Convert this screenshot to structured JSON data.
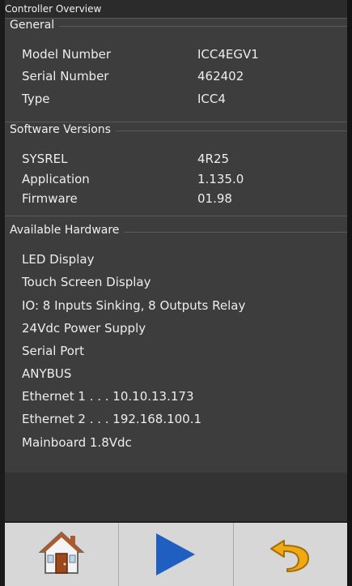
{
  "window": {
    "title": "Controller Overview"
  },
  "general": {
    "header": "General",
    "rows": [
      {
        "label": "Model Number",
        "value": "ICC4EGV1"
      },
      {
        "label": "Serial Number",
        "value": "462402"
      },
      {
        "label": "Type",
        "value": "ICC4"
      }
    ]
  },
  "software": {
    "header": "Software Versions",
    "rows": [
      {
        "label": "SYSREL",
        "value": "4R25"
      },
      {
        "label": "Application",
        "value": "1.135.0"
      },
      {
        "label": "Firmware",
        "value": "01.98"
      }
    ]
  },
  "hardware": {
    "header": "Available Hardware",
    "items": [
      "LED Display",
      "Touch Screen Display",
      "IO: 8 Inputs Sinking, 8 Outputs Relay",
      "24Vdc Power Supply",
      "Serial Port",
      "ANYBUS",
      "Ethernet 1 . . . 10.10.13.173",
      "Ethernet 2 . . . 192.168.100.1",
      "Mainboard 1.8Vdc"
    ]
  },
  "toolbar": {
    "home_icon": "home-icon",
    "play_icon": "play-icon",
    "back_icon": "undo-arrow-icon"
  }
}
